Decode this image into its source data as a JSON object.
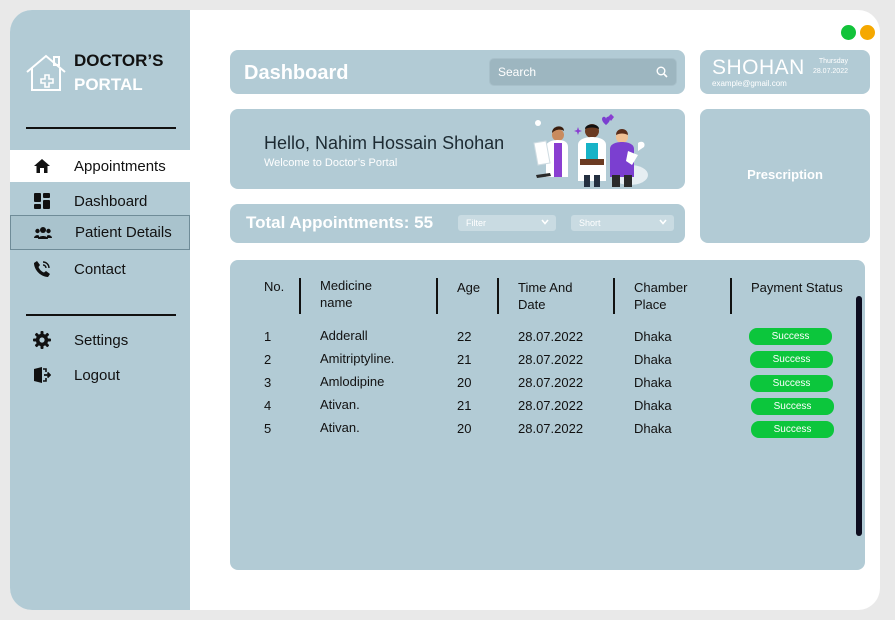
{
  "app": {
    "logo_line1": "DOCTOR’S",
    "logo_line2": "PORTAL"
  },
  "sidebar": {
    "items": [
      {
        "label": "Appointments",
        "icon": "home-icon"
      },
      {
        "label": "Dashboard",
        "icon": "dashboard-icon"
      },
      {
        "label": "Patient Details",
        "icon": "users-icon"
      },
      {
        "label": "Contact",
        "icon": "phone-icon"
      }
    ],
    "bottom_items": [
      {
        "label": "Settings",
        "icon": "gear-icon"
      },
      {
        "label": "Logout",
        "icon": "logout-icon"
      }
    ]
  },
  "header": {
    "title": "Dashboard",
    "search_placeholder": "Search"
  },
  "user": {
    "name": "SHOHAN",
    "email": "example@gmail.com",
    "day": "Thursday",
    "date": "28.07.2022"
  },
  "welcome": {
    "greeting": "Hello, Nahim Hossain Shohan",
    "subtitle": "Welcome to Doctor’s Portal"
  },
  "prescription": {
    "label": "Prescription"
  },
  "appointments": {
    "total_label": "Total Appointments:",
    "total_count": "55",
    "filter_label": "Filter",
    "sort_label": "Short"
  },
  "table": {
    "headers": {
      "no": "No.",
      "medicine_1": "Medicine",
      "medicine_2": "name",
      "age": "Age",
      "time_1": "Time And",
      "time_2": "Date",
      "chamber_1": "Chamber",
      "chamber_2": "Place",
      "payment": "Payment Status"
    },
    "rows": [
      {
        "no": "1",
        "medicine": "Adderall",
        "age": "22",
        "date": "28.07.2022",
        "place": "Dhaka",
        "status": "Success"
      },
      {
        "no": "2",
        "medicine": "Amitriptyline.",
        "age": "21",
        "date": "28.07.2022",
        "place": "Dhaka",
        "status": "Success"
      },
      {
        "no": "3",
        "medicine": "Amlodipine",
        "age": "20",
        "date": "28.07.2022",
        "place": "Dhaka",
        "status": "Success"
      },
      {
        "no": "4",
        "medicine": "Ativan.",
        "age": "21",
        "date": "28.07.2022",
        "place": "Dhaka",
        "status": "Success"
      },
      {
        "no": "5",
        "medicine": "Ativan.",
        "age": "20",
        "date": "28.07.2022",
        "place": "Dhaka",
        "status": "Success"
      }
    ]
  },
  "colors": {
    "accent": "#b2cbd5",
    "success": "#0cc63c",
    "window_green": "#12c33a",
    "window_orange": "#f5a800"
  }
}
